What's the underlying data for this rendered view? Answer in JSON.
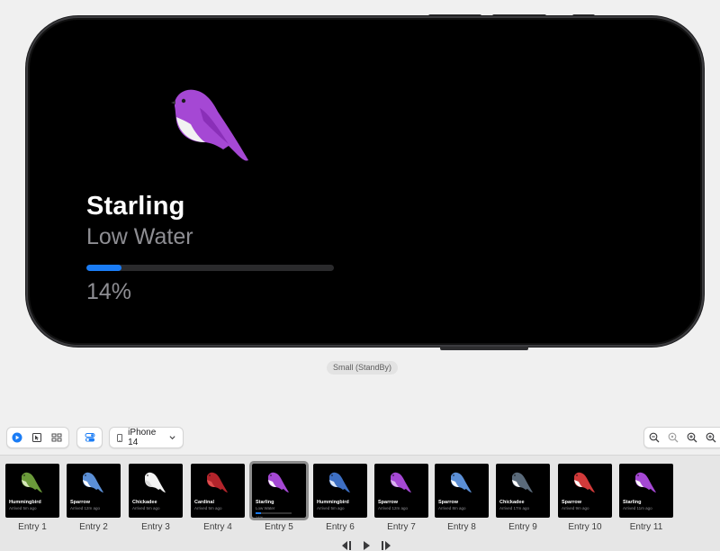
{
  "widget": {
    "title": "Starling",
    "subtitle": "Low Water",
    "progress_fraction": 0.14,
    "progress_text": "14%",
    "family_label": "Small (StandBy)"
  },
  "toolbar": {
    "preview_icon": "play-circle-icon",
    "select_icon": "cursor-icon",
    "grid_icon": "grid-icon",
    "variants_icon": "toggles-icon",
    "device": "iPhone 14",
    "zoom_icons": [
      "zoom-out-icon",
      "zoom-fit-icon",
      "zoom-in-icon",
      "zoom-actual-icon"
    ]
  },
  "entries": [
    {
      "label": "Entry 1",
      "title": "Hummingbird",
      "sub": "Arrived 5m ago",
      "bird_color": "#6b9a3a",
      "chest": "#d7e6b9"
    },
    {
      "label": "Entry 2",
      "title": "Sparrow",
      "sub": "Arrived 12m ago",
      "bird_color": "#5b8fd6",
      "chest": "#ffffff"
    },
    {
      "label": "Entry 3",
      "title": "Chickadee",
      "sub": "Arrived 5m ago",
      "bird_color": "#f2f2f2",
      "chest": "#d9d9d9"
    },
    {
      "label": "Entry 4",
      "title": "Cardinal",
      "sub": "Arrived 5m ago",
      "bird_color": "#b3242b",
      "chest": "#e05050"
    },
    {
      "label": "Entry 5",
      "title": "Starling",
      "sub": "Low Water",
      "bird_color": "#a548d4",
      "chest": "#ffffff",
      "pct": "14%",
      "progress_fraction": 0.14
    },
    {
      "label": "Entry 6",
      "title": "Hummingbird",
      "sub": "Arrived 5m ago",
      "bird_color": "#3d6fc4",
      "chest": "#dbe6f7"
    },
    {
      "label": "Entry 7",
      "title": "Sparrow",
      "sub": "Arrived 12m ago",
      "bird_color": "#a548d4",
      "chest": "#d9b3ee"
    },
    {
      "label": "Entry 8",
      "title": "Sparrow",
      "sub": "Arrived 8m ago",
      "bird_color": "#5b8fd6",
      "chest": "#ffffff"
    },
    {
      "label": "Entry 9",
      "title": "Chickadee",
      "sub": "Arrived 17m ago",
      "bird_color": "#5a6a7a",
      "chest": "#ffffff"
    },
    {
      "label": "Entry 10",
      "title": "Sparrow",
      "sub": "Arrived 9m ago",
      "bird_color": "#d23a3a",
      "chest": "#ffffff"
    },
    {
      "label": "Entry 11",
      "title": "Starling",
      "sub": "Arrived 11m ago",
      "bird_color": "#a548d4",
      "chest": "#ffffff"
    }
  ],
  "playback": [
    "step-back-icon",
    "play-icon",
    "step-forward-icon"
  ],
  "colors": {
    "accent": "#1a7cf5",
    "device_background": "#000000",
    "window_background": "#f0f0f0"
  }
}
